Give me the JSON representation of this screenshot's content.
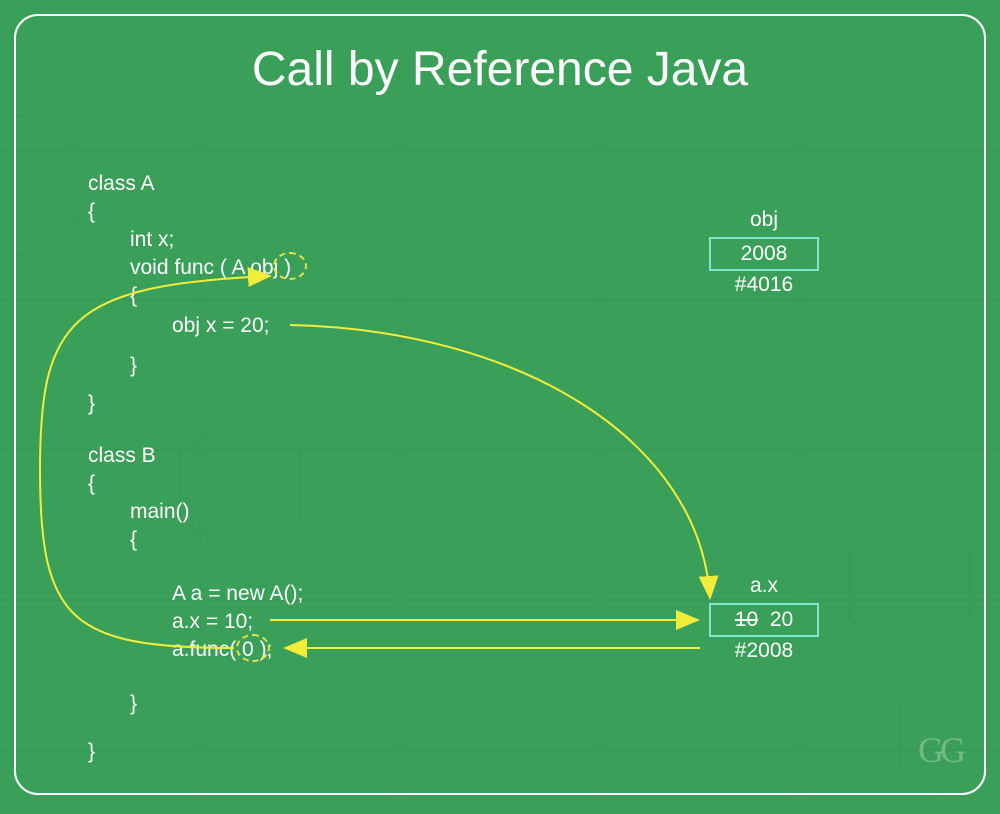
{
  "title": "Call by Reference Java",
  "code": {
    "classA": {
      "decl": "class A",
      "open": "{",
      "line1": "int x;",
      "line2_pre": "void func ( A ",
      "line2_obj": "obj",
      "line2_post": " )",
      "innerOpen": "{",
      "body": "obj x = 20;",
      "innerClose": "}",
      "close": "}"
    },
    "classB": {
      "decl": "class B",
      "open": "{",
      "mainDecl": "main()",
      "mainOpen": "{",
      "line1": "A a = new A();",
      "line2": "a.x = 10;",
      "line3_pre": "a.func( ",
      "line3_arg": "0",
      "line3_post": " );",
      "mainClose": "}",
      "close": "}"
    }
  },
  "memory": {
    "obj": {
      "label": "obj",
      "value": "2008",
      "address": "#4016"
    },
    "ax": {
      "label": "a.x",
      "old": "10",
      "new": "20",
      "address": "#2008"
    }
  },
  "colors": {
    "bg": "#3a9f58",
    "boxBorder": "#7ce8c8",
    "arrow": "#f2ed3a",
    "highlight": "#e4e04a"
  },
  "logo": "GG"
}
